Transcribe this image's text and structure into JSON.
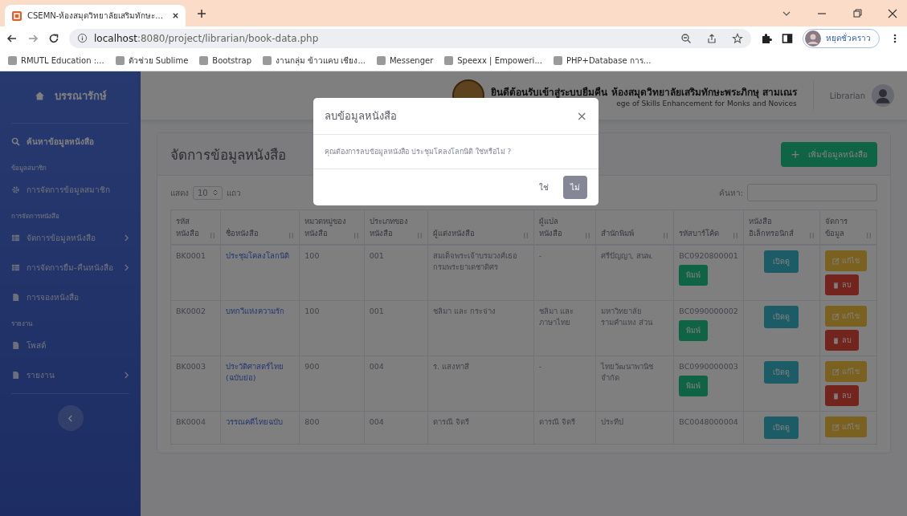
{
  "browser": {
    "tab": {
      "title": "CSEMN-ห้องสมุดวิทยาลัยเสริมทักษะ..."
    },
    "url_host": "localhost",
    "url_path": ":8080/project/librarian/book-data.php",
    "profile_label": "หยุดชั่วคราว",
    "bookmarks": [
      {
        "label": "RMUTL Education :..."
      },
      {
        "label": "ตัวช่วย Sublime"
      },
      {
        "label": "Bootstrap"
      },
      {
        "label": "งานกลุ่ม ข้าวแคบ เชียง..."
      },
      {
        "label": "Messenger"
      },
      {
        "label": "Speexx | Empoweri..."
      },
      {
        "label": "PHP+Database การ..."
      }
    ]
  },
  "sidebar": {
    "brand": "บรรณารักษ์",
    "items": [
      {
        "kind": "link",
        "label": "ค้นหาข้อมูลหนังสือ",
        "selected": true,
        "has_arrow": false
      },
      {
        "kind": "heading",
        "label": "ข้อมูลสมาชิก"
      },
      {
        "kind": "link",
        "label": "การจัดการข้อมูลสมาชิก",
        "selected": false,
        "has_arrow": false
      },
      {
        "kind": "heading",
        "label": "การจัดการหนังสือ"
      },
      {
        "kind": "link",
        "label": "จัดการข้อมูลหนังสือ",
        "selected": false,
        "has_arrow": true
      },
      {
        "kind": "link",
        "label": "การจัดการยืม-คืนหนังสือ",
        "selected": false,
        "has_arrow": true
      },
      {
        "kind": "link",
        "label": "การจองหนังสือ",
        "selected": false,
        "has_arrow": false
      },
      {
        "kind": "heading",
        "label": "รายงาน"
      },
      {
        "kind": "link",
        "label": "โพสต์",
        "selected": false,
        "has_arrow": false
      },
      {
        "kind": "link",
        "label": "รายงาน",
        "selected": false,
        "has_arrow": true
      }
    ]
  },
  "topbar": {
    "title": "ยินดีต้อนรับเข้าสู่ระบบยืมคืน ห้องสมุดวิทยาลัยเสริมทักษะพระภิกษุ สามเณร",
    "subtitle": "ege of Skills Enhancement for Monks and Novices",
    "user_label": "Librarian"
  },
  "card": {
    "title": "จัดการข้อมูลหนังสือ",
    "add_button": "เพิ่มข้อมูลหนังสือ",
    "add_icon": "+",
    "show_label": "แสดง",
    "page_size": "10",
    "rows_label": "แถว",
    "search_label": "ค้นหา:"
  },
  "table": {
    "columns": [
      {
        "label": "รหัสหนังสือ"
      },
      {
        "label": "ชื่อหนังสือ"
      },
      {
        "label": "หมวดหมู่ของหนังสือ"
      },
      {
        "label": "ประเภทของหนังสือ"
      },
      {
        "label": "ผู้แต่งหนังสือ"
      },
      {
        "label": "ผู้แปลหนังสือ"
      },
      {
        "label": "สำนักพิมพ์"
      },
      {
        "label": "รหัสบาร์โค้ด"
      },
      {
        "label": "หนังสืออิเล็กทรอนิกส์"
      },
      {
        "label": "จัดการข้อมูล"
      }
    ],
    "rows": [
      {
        "code": "BK0001",
        "name": "ประชุมโคลงโลกนิติ",
        "category": "100",
        "type": "001",
        "author": "สมเด็จพระเจ้าบรมวงศ์เธอ กรมพระยาเดชาดิศร",
        "translator": "-",
        "publisher": "ศรีปัญญา, สนพ.",
        "barcode": "BC0920800001",
        "print": "พิมพ์",
        "view": "เปิดดู",
        "edit": "แก้ไข",
        "delete": "ลบ"
      },
      {
        "code": "BK0002",
        "name": "บทกวีแห่งความรัก",
        "category": "100",
        "type": "001",
        "author": "ชลิมา และ กระจ่าง",
        "translator": "ชลิมา และ ภาษาไทย",
        "publisher": "มหาวิทยาลัยรามคำแหง ส่วน",
        "barcode": "BC0990000002",
        "print": "พิมพ์",
        "view": "เปิดดู",
        "edit": "แก้ไข",
        "delete": "ลบ"
      },
      {
        "code": "BK0003",
        "name": "ประวัติศาสตร์ไทย (ฉบับย่อ)",
        "category": "900",
        "type": "004",
        "author": "ร. แสงทาสี",
        "translator": "-",
        "publisher": "ไทยวัฒนาพานิช จำกัด",
        "barcode": "BC0990000003",
        "print": "พิมพ์",
        "view": "เปิดดู",
        "edit": "แก้ไข",
        "delete": "ลบ"
      },
      {
        "code": "BK0004",
        "name": "วรรณคดีไทยฉบับ",
        "category": "800",
        "type": "004",
        "author": "ดารณี จิตรี",
        "translator": "ดารณี จิตรี",
        "publisher": "ประทีป",
        "barcode": "BC0048000004",
        "view": "เปิดดู",
        "edit": "แก้ไข"
      }
    ]
  },
  "modal": {
    "title": "ลบข้อมูลหนังสือ",
    "close": "×",
    "message": "คุณต้องการลบข้อมูลหนังสือ ประชุมโคลงโลกนิติ ใช่หรือไม่ ?",
    "confirm": "ใช่",
    "cancel": "ไม่"
  }
}
